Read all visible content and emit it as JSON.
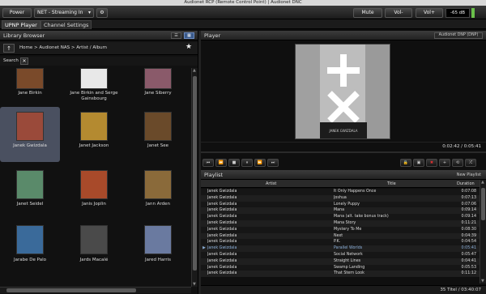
{
  "window": {
    "title": "Audionet RCP (Remote Control Point) | Audionet DNC"
  },
  "toolbar": {
    "power_label": "Power",
    "source_label": "NET - Streaming In",
    "mute_label": "Mute",
    "vol_down_label": "Vol-",
    "vol_up_label": "Vol+",
    "volume_value": "-65 dB"
  },
  "tabs": [
    {
      "label": "UPNP Player"
    },
    {
      "label": "Channel Settings"
    }
  ],
  "library": {
    "title": "Library Browser",
    "breadcrumb": [
      "Home",
      "Audionet NAS",
      "Artist / Album"
    ],
    "search_label": "Search",
    "artists": [
      {
        "name": "Jane Birkin",
        "color": "#7a4a2a"
      },
      {
        "name": "Jane Birkin and Serge Gainsbourg",
        "color": "#e8e8e8"
      },
      {
        "name": "Jane Siberry",
        "color": "#8a5a6a"
      },
      {
        "name": "Janek Gwizdala",
        "color": "#9a4a3a"
      },
      {
        "name": "Janet Jackson",
        "color": "#b48a30"
      },
      {
        "name": "Janet See",
        "color": "#6a4a2a"
      },
      {
        "name": "Janet Seidel",
        "color": "#5a8a6a"
      },
      {
        "name": "Janis Joplin",
        "color": "#a84a2a"
      },
      {
        "name": "Jann Arden",
        "color": "#8a6a3a"
      },
      {
        "name": "Jarabe De Palo",
        "color": "#3a6a9a"
      },
      {
        "name": "Jards Macalé",
        "color": "#4a4a4a"
      },
      {
        "name": "Jared Harris",
        "color": "#6a7aa0"
      }
    ]
  },
  "player": {
    "title": "Player",
    "device_label": "Audionet DNP (DNP)",
    "time": "0:02:42 / 0:05:41",
    "album_text": "JANEK GWIZDALA"
  },
  "playlist": {
    "title": "Playlist",
    "new_label": "New Playlist",
    "headers": {
      "artist": "Artist",
      "title": "Title",
      "duration": "Duration"
    },
    "rows": [
      {
        "artist": "Janek Gwizdala",
        "title": "It Only Happens Once",
        "duration": "0:07:08"
      },
      {
        "artist": "Janek Gwizdala",
        "title": "Joshua",
        "duration": "0:07:13"
      },
      {
        "artist": "Janek Gwizdala",
        "title": "Lonely Puppy",
        "duration": "0:07:06"
      },
      {
        "artist": "Janek Gwizdala",
        "title": "Mana",
        "duration": "0:09:14"
      },
      {
        "artist": "Janek Gwizdala",
        "title": "Mana (alt. take bonus track)",
        "duration": "0:09:14"
      },
      {
        "artist": "Janek Gwizdala",
        "title": "Mana Story",
        "duration": "0:11:21"
      },
      {
        "artist": "Janek Gwizdala",
        "title": "Mystery To Me",
        "duration": "0:08:30"
      },
      {
        "artist": "Janek Gwizdala",
        "title": "Next",
        "duration": "0:04:39"
      },
      {
        "artist": "Janek Gwizdala",
        "title": "P.K.",
        "duration": "0:04:54"
      },
      {
        "artist": "Janek Gwizdala",
        "title": "Parallel Worlds",
        "duration": "0:05:41"
      },
      {
        "artist": "Janek Gwizdala",
        "title": "Social Network",
        "duration": "0:05:47"
      },
      {
        "artist": "Janek Gwizdala",
        "title": "Straight Lines",
        "duration": "0:04:41"
      },
      {
        "artist": "Janek Gwizdala",
        "title": "Swamp Landing",
        "duration": "0:05:53"
      },
      {
        "artist": "Janek Gwizdala",
        "title": "That Stern Look",
        "duration": "0:11:12"
      }
    ],
    "footer": "35 Titel / 03:40:07"
  }
}
